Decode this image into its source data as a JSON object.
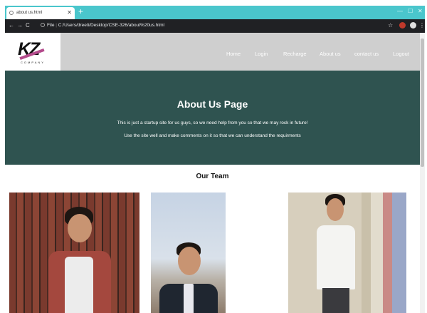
{
  "browser": {
    "tab_title": "about us.html",
    "url_scheme_label": "File",
    "url": "C:/Users/dreeti/Desktop/CSE-326/about%20us.html"
  },
  "nav": {
    "items": [
      {
        "label": "Home"
      },
      {
        "label": "Login"
      },
      {
        "label": "Recharge"
      },
      {
        "label": "About us"
      },
      {
        "label": "contact us"
      },
      {
        "label": "Logout"
      }
    ]
  },
  "logo": {
    "mark": "KZ",
    "sub": "COMPANY"
  },
  "hero": {
    "title": "About Us Page",
    "line1": "This is just a startup site for us guys, so we need help from you so that we may rock in future!",
    "line2": "Use the site well and make comments on it so that we can understand the requirments"
  },
  "team": {
    "title": "Our Team"
  },
  "colors": {
    "chrome_tabbar": "#4ac6cc",
    "header_bg": "#cfcfcf",
    "hero_bg": "#2f5350"
  }
}
